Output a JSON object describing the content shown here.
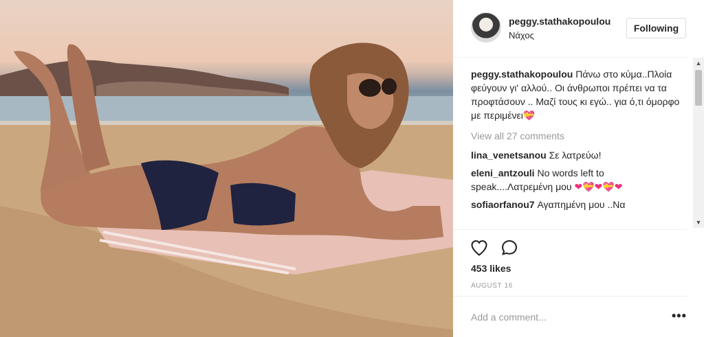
{
  "post": {
    "username": "peggy.stathakopoulou",
    "location": "Νάχος",
    "follow_label": "Following",
    "caption_user": "peggy.stathakopoulou",
    "caption_text": "Πάνω στο κύμα..Πλοία φεύγουν γι' αλλού.. Οι άνθρωποι πρέπει να τα προφτάσουν .. Μαζί τους κι εγώ.. για ό,τι όμορφο με περιμένει",
    "caption_emoji": "💝",
    "view_all": "View all 27 comments",
    "comments": [
      {
        "user": "lina_venetsanou",
        "text": "Σε λατρεύω!"
      },
      {
        "user": "eleni_antzouli",
        "text": "No words left to speak....Λατρεμένη μου",
        "emoji": "❤💝❤💝❤"
      },
      {
        "user": "sofiaorfanou7",
        "text": "Αγαπημένη μου ..Να"
      }
    ],
    "likes": "453 likes",
    "date": "AUGUST 16",
    "comment_placeholder": "Add a comment...",
    "more_label": "•••"
  },
  "icons": {
    "like": "heart-icon",
    "comment": "comment-bubble-icon",
    "scroll_up": "scroll-up-arrow",
    "scroll_down": "scroll-down-arrow"
  },
  "colors": {
    "text": "#262626",
    "muted": "#999999",
    "border": "#dbdbdb",
    "heart_emoji": "#ed2f7a"
  }
}
